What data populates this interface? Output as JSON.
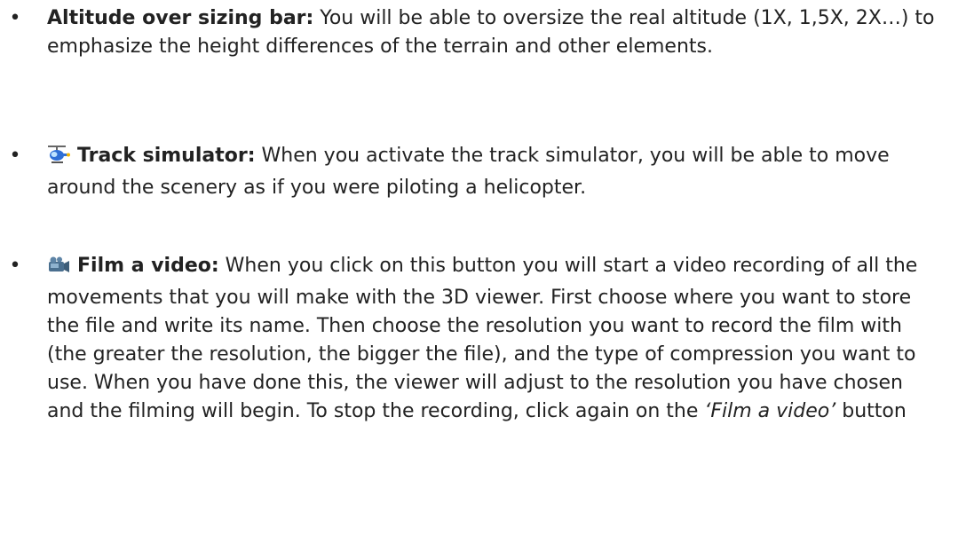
{
  "bullet_glyph": "•",
  "items": [
    {
      "title": "Altitude over sizing bar:",
      "text": " You will be able to oversize the real altitude (1X, 1,5X, 2X…) to emphasize the height differences of the terrain and other elements."
    },
    {
      "icon": "helicopter-icon",
      "title": "Track simulator:",
      "text": " When you activate the track simulator, you will be able to move around the scenery as if you were piloting a helicopter."
    },
    {
      "icon": "video-camera-icon",
      "title": "Film a video:",
      "text": " When you click on this button you will start a video recording of all the movements that you will make with the 3D viewer. First choose where you want to store the file and write its name. Then choose the resolution you want to record the film with (the greater the resolution, the bigger the file), and the type of compression you want to use. When you have done this, the viewer will adjust to the resolution you have chosen and the filming will begin. To stop the recording, click again on the ",
      "emphasis": "‘Film a video’",
      "text_end": " button"
    }
  ]
}
